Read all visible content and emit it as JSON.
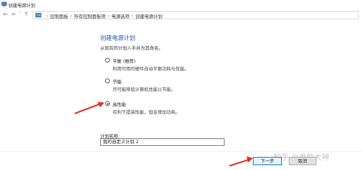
{
  "window": {
    "title": "创建电源计划"
  },
  "address_bar": {
    "crumbs": [
      "控制面板",
      "所有控制面板项",
      "电源选项",
      "创建电源计划"
    ]
  },
  "main": {
    "heading": "创建电源计划",
    "subtitle": "从现有的计划入手并为其命名。",
    "options": [
      {
        "name": "平衡 (推荐)",
        "desc": "利用可用的硬件自动平衡功耗与性能。",
        "checked": false
      },
      {
        "name": "节能",
        "desc": "尽可能降低计算机性能以节能。",
        "checked": false
      },
      {
        "name": "高性能",
        "desc": "有利于提高性能，但会增加功耗。",
        "checked": true
      }
    ],
    "plan_name_label": "计划名称:",
    "plan_name_value": "我的自定义计划 2"
  },
  "footer": {
    "next_label": "下一步",
    "cancel_label": "取消"
  },
  "watermark": "知乎 @电脑大神",
  "colors": {
    "heading": "#1e5aa8",
    "annotation_arrow": "#e0301e",
    "primary_button_border": "#0078d7"
  }
}
